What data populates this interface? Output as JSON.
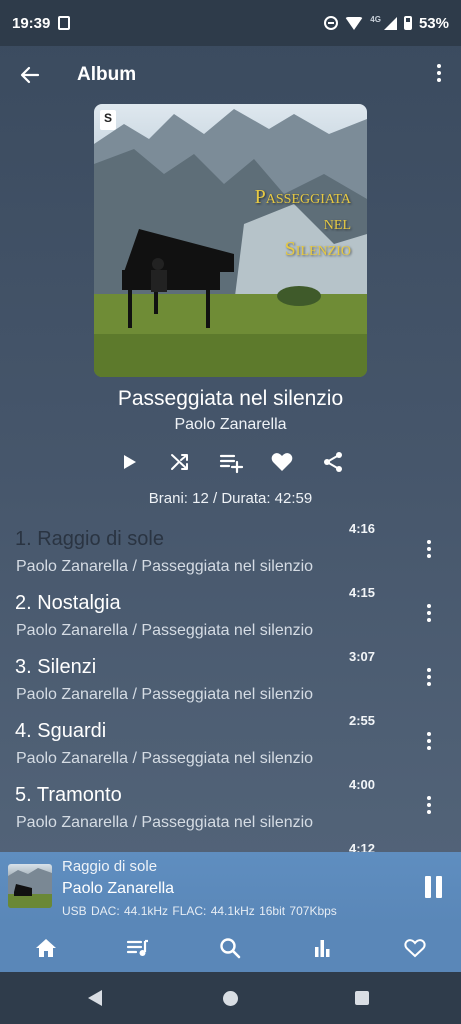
{
  "status_bar": {
    "time": "19:39",
    "network": "4G",
    "battery": "53%",
    "icons": [
      "screenshot-notification-icon",
      "dnd-icon",
      "wifi-icon",
      "signal-icon",
      "battery-icon"
    ]
  },
  "app_bar": {
    "title": "Album",
    "icons": [
      "back-arrow-icon",
      "more-vert-icon"
    ]
  },
  "album": {
    "art_title": [
      "Passeggiata",
      "nel",
      "Silenzio"
    ],
    "name": "Passeggiata nel silenzio",
    "artist": "Paolo Zanarella",
    "stats": "Brani: 12 / Durata: 42:59",
    "actions": [
      "play-icon",
      "shuffle-icon",
      "add-to-playlist-icon",
      "favorite-icon",
      "share-icon"
    ]
  },
  "tracks": [
    {
      "title": "1. Raggio di sole",
      "subtitle": "Paolo Zanarella / Passeggiata nel silenzio",
      "duration": "4:16",
      "active": true
    },
    {
      "title": "2. Nostalgia",
      "subtitle": "Paolo Zanarella / Passeggiata nel silenzio",
      "duration": "4:15",
      "active": false
    },
    {
      "title": "3. Silenzi",
      "subtitle": "Paolo Zanarella / Passeggiata nel silenzio",
      "duration": "3:07",
      "active": false
    },
    {
      "title": "4. Sguardi",
      "subtitle": "Paolo Zanarella / Passeggiata nel silenzio",
      "duration": "2:55",
      "active": false
    },
    {
      "title": "5. Tramonto",
      "subtitle": "Paolo Zanarella / Passeggiata nel silenzio",
      "duration": "4:00",
      "active": false
    },
    {
      "title": "",
      "subtitle": "",
      "duration": "4:12",
      "active": false
    }
  ],
  "player": {
    "title": "Raggio di sole",
    "artist": "Paolo Zanarella",
    "info": "USB DAC: 44.1kHz  FLAC: 44.1kHz  16bit  707Kbps"
  },
  "bottom_nav": [
    "home-icon",
    "queue-music-icon",
    "search-icon",
    "equalizer-icon",
    "favorite-outline-icon"
  ],
  "colors": {
    "background": "#46566b",
    "player": "#5f8ec0",
    "accent_title": "#e6c943"
  }
}
